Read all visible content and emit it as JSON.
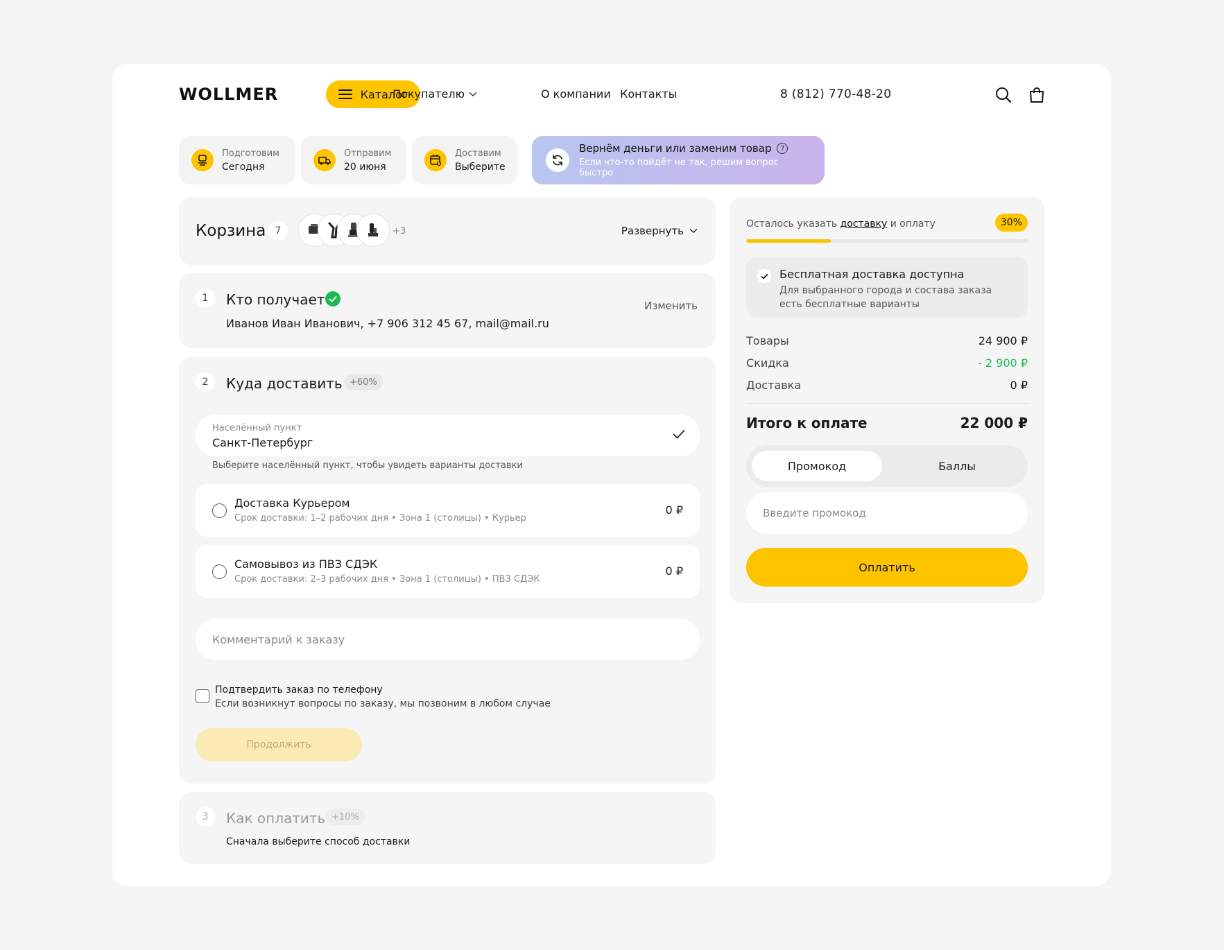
{
  "header": {
    "logo": "WOLLMER",
    "catalog_label": "Каталог",
    "nav": [
      {
        "label": "Покупателю",
        "has_dropdown": true
      },
      {
        "label": "О компании"
      },
      {
        "label": "Контакты"
      }
    ],
    "phone": "8 (812) 770-48-20",
    "icons": [
      "search-icon",
      "cart-bag-icon"
    ]
  },
  "badges": [
    {
      "title": "Подготовим",
      "value": "Сегодня",
      "icon": "box-icon"
    },
    {
      "title": "Отправим",
      "value": "20 июня",
      "icon": "truck-icon"
    },
    {
      "title": "Доставим",
      "value": "Выберите",
      "icon": "calendar-icon"
    }
  ],
  "guarantee": {
    "title": "Вернём деньги или заменим товар",
    "subtitle": "Если что-то пойдёт не так, решим вопрос быстро",
    "help": "?",
    "icon": "refresh-icon"
  },
  "cart": {
    "title": "Корзина",
    "count": "7",
    "more": "+3",
    "expand_label": "Развернуть"
  },
  "steps": {
    "recipient": {
      "num": "1",
      "title": "Кто получает",
      "change": "Изменить",
      "info": "Иванов Иван Иванович, +7 906 312 45 67, mail@mail.ru"
    },
    "delivery": {
      "num": "2",
      "title": "Куда доставить",
      "bonus": "+60%",
      "city_label": "Населённый пункт",
      "city_value": "Санкт-Петербург",
      "city_hint": "Выберите населённый пункт, чтобы увидеть варианты доставки",
      "options": [
        {
          "title": "Доставка Курьером",
          "desc": "Срок доставки: 1–2 рабочих дня • Зона 1 (столицы) • Курьер",
          "price": "0 ₽"
        },
        {
          "title": "Самовывоз из ПВЗ СДЭК",
          "desc": "Срок доставки: 2–3 рабочих дня • Зона 1 (столицы) • ПВЗ СДЭК",
          "price": "0 ₽"
        }
      ],
      "comment_placeholder": "Комментарий к заказу",
      "confirm_title": "Подтвердить заказ по телефону",
      "confirm_desc": "Если возникнут вопросы по заказу, мы позвоним в любом случае",
      "continue_label": "Продолжить"
    },
    "payment": {
      "num": "3",
      "title": "Как оплатить",
      "bonus": "+10%",
      "hint": "Сначала выберите способ доставки"
    }
  },
  "summary": {
    "remaining_prefix": "Осталось указать",
    "remaining_link": "доставку",
    "remaining_suffix": "и оплату",
    "progress_label": "30%",
    "progress": 0.3,
    "free_title": "Бесплатная доставка доступна",
    "free_desc": "Для выбранного города и состава заказа есть бесплатные варианты",
    "rows": [
      {
        "label": "Товары",
        "value": "24 900 ₽"
      },
      {
        "label": "Скидка",
        "value": "- 2 900 ₽"
      },
      {
        "label": "Доставка",
        "value": "0 ₽"
      }
    ],
    "total_label": "Итого к оплате",
    "total_value": "22 000 ₽",
    "tabs": [
      "Промокод",
      "Баллы"
    ],
    "promo_placeholder": "Введите промокод",
    "pay_label": "Оплатить"
  },
  "colors": {
    "accent": "#ffc400",
    "success": "#1db954",
    "card_bg": "#f5f5f5"
  }
}
